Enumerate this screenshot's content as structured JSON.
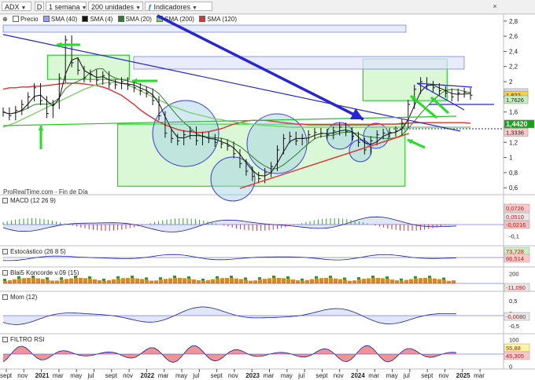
{
  "toolbar": {
    "symbol": "ADX",
    "mode": "D",
    "period": "1 semana",
    "units": "200 unidades",
    "indicators_label": "Indicadores",
    "close_label": "×"
  },
  "legend": [
    {
      "label": "Precio",
      "color": "#ffffff"
    },
    {
      "label": "SMA (40)",
      "color": "#9c9cff"
    },
    {
      "label": "SMA (4)",
      "color": "#111111"
    },
    {
      "label": "SMA (20)",
      "color": "#2e7d2e"
    },
    {
      "label": "SMA (200)",
      "color": "#7fcf6a"
    },
    {
      "label": "SMA (120)",
      "color": "#e03030"
    }
  ],
  "source_note": "ProRealTime.com - Fin de Día",
  "price_axis": {
    "ticks": [
      "2,8",
      "2,6",
      "2,4",
      "2,2",
      "2",
      "1,8",
      "1,6",
      "1,4",
      "1,2",
      "1",
      "0,8",
      "0,6"
    ],
    "badges": [
      {
        "label": "1,8562",
        "color": "#cfd8ff"
      },
      {
        "label": "1,822",
        "color": "#ffd23a"
      },
      {
        "label": "1,7626",
        "color": "#c6f0c0"
      },
      {
        "label": "1,4420",
        "color": "#18a018"
      },
      {
        "label": "1,3336",
        "color": "#ffc8c8"
      }
    ]
  },
  "x_axis": {
    "labels": [
      "sept",
      "nov",
      "2021",
      "mar",
      "may",
      "jul",
      "sept",
      "nov",
      "2022",
      "mar",
      "may",
      "jul",
      "sept",
      "nov",
      "2023",
      "mar",
      "may",
      "jul",
      "sept",
      "nov",
      "2024",
      "mar",
      "may",
      "jul",
      "sept",
      "nov",
      "2025",
      "mar"
    ]
  },
  "panels": {
    "macd": {
      "title": "MACD (12 26 9)",
      "ticks": [
        "0,1",
        "-0,1"
      ],
      "badges": [
        {
          "label": "0,0726",
          "color": "#ffc8c8"
        },
        {
          "label": "0,0510",
          "color": "#e8e8e8"
        },
        {
          "label": "-0,0216",
          "color": "#f3c0c0"
        }
      ]
    },
    "stoch": {
      "title": "Estocástico (26 8 5)",
      "badges": [
        {
          "label": "73,728",
          "color": "#c6f0c0"
        },
        {
          "label": "66,514",
          "color": "#ffc8c8"
        }
      ]
    },
    "koncorde": {
      "title": "Blai5 Koncorde v.09 (15)",
      "ticks": [
        "200",
        "0"
      ],
      "badges": [
        {
          "label": "-11,090",
          "color": "#e8e8e8"
        }
      ]
    },
    "mom": {
      "title": "Mom (12)",
      "ticks": [
        "0,5",
        "0",
        "-0,5"
      ],
      "badges": [
        {
          "label": "-0,0080",
          "color": "#e8e8e8"
        }
      ]
    },
    "rsi": {
      "title": "FILTRO RSI",
      "ticks": [
        "100",
        "50",
        "0"
      ],
      "badges": [
        {
          "label": "55,88",
          "color": "#fff4a0"
        },
        {
          "label": "45,305",
          "color": "#ffc8c8"
        }
      ]
    }
  },
  "chart_data": {
    "type": "line",
    "title": "ADX",
    "x_start": "2020-09",
    "ylim": [
      0.55,
      2.85
    ],
    "price": [
      1.6,
      1.55,
      1.62,
      1.7,
      1.8,
      1.92,
      1.75,
      1.58,
      1.7,
      2.05,
      2.55,
      2.25,
      2.15,
      2.05,
      2.1,
      2.02,
      2.08,
      1.97,
      1.96,
      2.0,
      1.95,
      1.92,
      1.88,
      1.85,
      1.75,
      1.55,
      1.32,
      1.25,
      1.22,
      1.3,
      1.35,
      1.22,
      1.28,
      1.25,
      1.2,
      1.18,
      1.15,
      1.05,
      0.92,
      0.82,
      0.75,
      0.72,
      0.8,
      0.88,
      1.1,
      1.25,
      1.28,
      1.22,
      1.25,
      1.3,
      1.33,
      1.32,
      1.3,
      1.35,
      1.4,
      1.34,
      1.28,
      1.2,
      1.1,
      1.22,
      1.3,
      1.32,
      1.33,
      1.35,
      1.45,
      1.7,
      1.9,
      2.0,
      1.95,
      1.92,
      1.88,
      1.85,
      1.8,
      1.85,
      1.86,
      1.822
    ],
    "series": [
      {
        "name": "SMA (120)",
        "values": [
          1.9,
          1.92,
          1.92,
          1.93,
          1.93,
          1.94,
          1.94,
          1.95,
          1.96,
          1.97,
          1.98,
          1.98,
          1.98,
          1.97,
          1.96,
          1.95,
          1.93,
          1.9,
          1.86,
          1.82,
          1.76,
          1.7,
          1.63,
          1.57,
          1.52,
          1.47,
          1.43,
          1.4,
          1.37,
          1.35,
          1.34,
          1.33,
          1.33,
          1.34,
          1.36,
          1.38,
          1.41,
          1.44,
          1.46,
          1.48,
          1.49,
          1.49,
          1.49,
          1.48,
          1.47,
          1.46,
          1.45,
          1.44,
          1.44,
          1.43,
          1.43,
          1.43,
          1.43,
          1.43,
          1.43,
          1.43,
          1.43,
          1.43,
          1.43,
          1.43,
          1.44,
          1.44,
          1.44,
          1.44,
          1.45,
          1.45,
          1.46,
          1.46,
          1.46,
          1.46,
          1.46,
          1.46,
          1.46,
          1.46,
          1.46,
          1.45
        ]
      },
      {
        "name": "SMA (200)",
        "values": [
          1.4,
          1.43,
          1.46,
          1.5,
          1.54,
          1.58,
          1.62,
          1.66,
          1.7,
          1.74,
          1.78,
          1.82,
          1.86,
          1.9,
          1.93,
          1.96,
          1.98,
          1.99,
          1.99,
          1.98,
          1.96,
          1.92,
          1.88,
          1.84,
          1.8,
          1.76,
          1.72,
          1.68,
          1.65,
          1.62,
          1.59,
          1.57,
          1.55,
          1.53,
          1.51,
          1.5,
          1.48,
          1.47,
          1.46,
          1.45,
          1.44,
          1.43,
          1.42,
          1.42,
          1.41,
          1.41,
          1.4,
          1.4,
          1.4,
          1.4,
          1.4,
          1.4,
          1.4,
          1.4,
          1.4,
          1.4,
          1.4,
          1.4,
          1.4,
          1.4,
          1.4,
          1.4,
          1.4,
          1.4,
          1.4,
          1.4,
          1.4,
          1.4,
          1.4,
          1.4,
          1.4,
          1.4,
          1.4,
          1.4,
          1.4,
          1.4
        ]
      }
    ],
    "zones": [
      {
        "from": 2.03,
        "to": 2.35,
        "x0": 0.095,
        "x1": 0.27
      },
      {
        "from": 0.62,
        "to": 1.44,
        "x0": 0.245,
        "x1": 0.86
      },
      {
        "from": 1.75,
        "to": 2.3,
        "x0": 0.77,
        "x1": 0.95
      }
    ],
    "key_level": 1.442
  }
}
